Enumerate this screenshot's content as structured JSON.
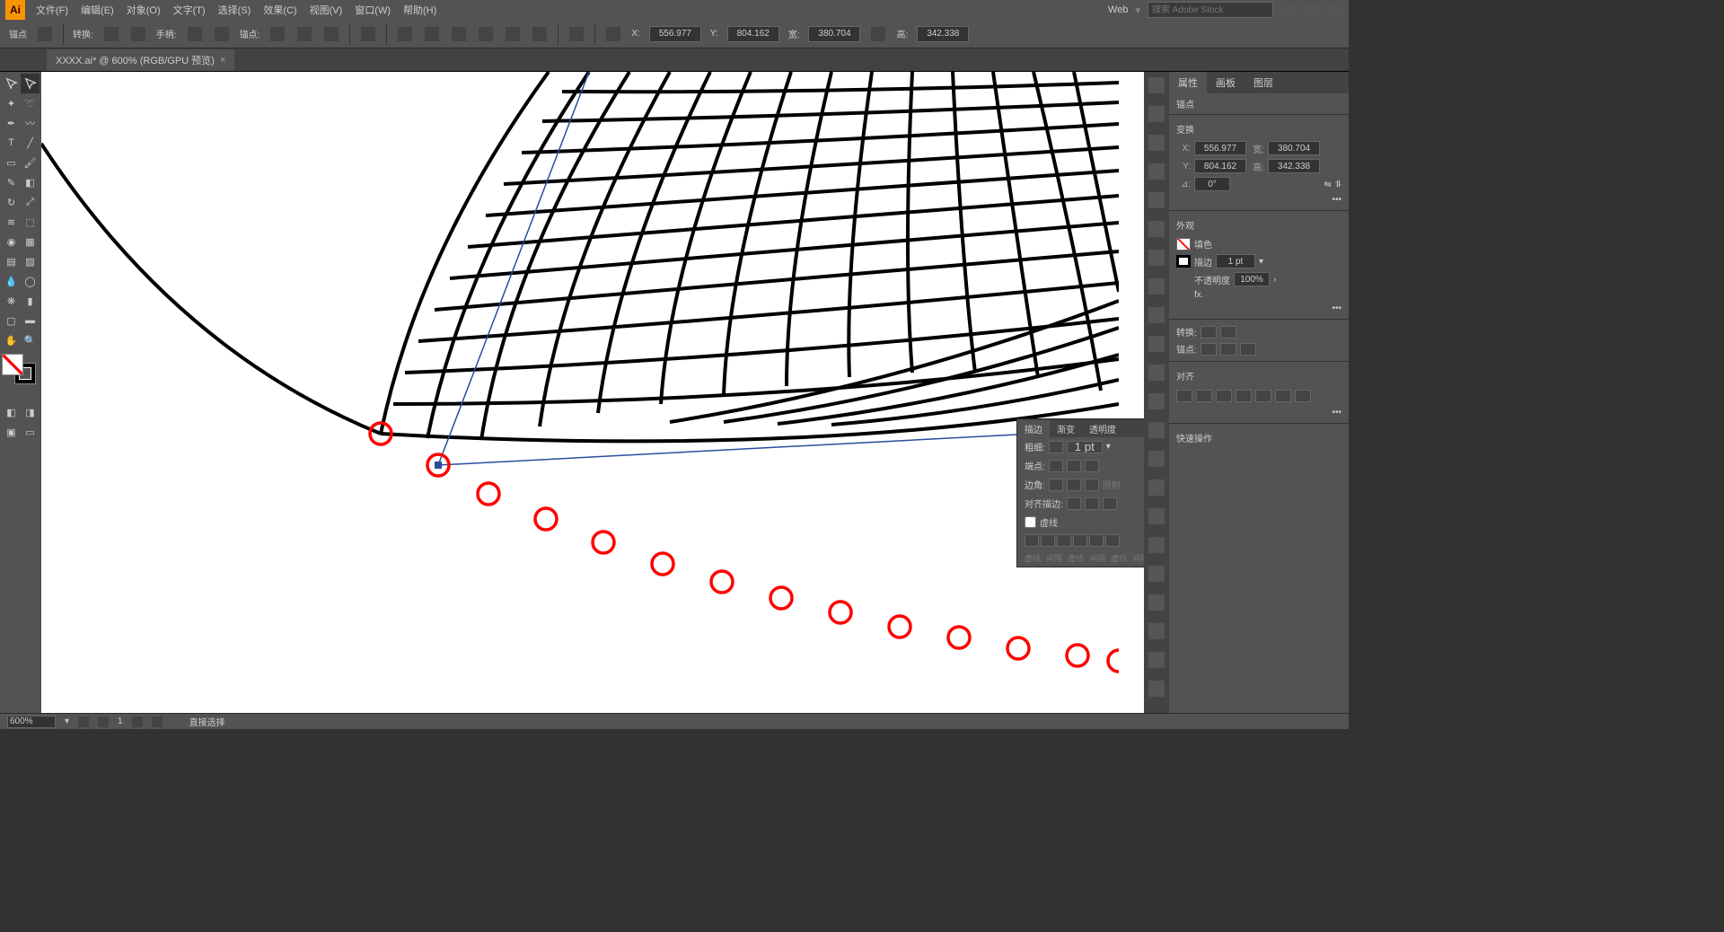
{
  "menubar": {
    "items": [
      "文件(F)",
      "编辑(E)",
      "对象(O)",
      "文字(T)",
      "选择(S)",
      "效果(C)",
      "视图(V)",
      "窗口(W)",
      "帮助(H)"
    ],
    "workspace": "Web",
    "search_placeholder": "搜索 Adobe Stock"
  },
  "controlbar": {
    "label_anchor": "锚点",
    "label_convert": "转换:",
    "label_handle": "手柄:",
    "label_anchor2": "锚点:",
    "label_x": "X:",
    "label_y": "Y:",
    "label_w": "宽:",
    "label_h": "高:",
    "x": "556.977",
    "y": "804.162",
    "w": "380.704",
    "h": "342.338"
  },
  "document": {
    "tab_label": "XXXX.ai* @ 600% (RGB/GPU 预览)"
  },
  "right_panel": {
    "tabs": [
      "属性",
      "画板",
      "图层"
    ],
    "sec_anchor": "锚点",
    "sec_transform": "变换",
    "tf": {
      "x_label": "X:",
      "y_label": "Y:",
      "w_label": "宽:",
      "h_label": "高:",
      "x": "556.977",
      "y": "804.162",
      "w": "380.704",
      "h": "342.338",
      "angle_label": "⊿:",
      "angle": "0°"
    },
    "sec_appearance": "外观",
    "fill_label": "填色",
    "stroke_label": "描边",
    "stroke_weight": "1 pt",
    "opacity_label": "不透明度",
    "opacity": "100%",
    "fx_label": "fx.",
    "sec_convert": "转换:",
    "sec_anchor3": "锚点:",
    "sec_align": "对齐",
    "sec_quick": "快速操作"
  },
  "float_stroke": {
    "tabs": [
      "描边",
      "渐变",
      "透明度"
    ],
    "weight_label": "粗细:",
    "weight": "1 pt",
    "cap_label": "端点:",
    "corner_label": "边角:",
    "limit_label": "限制:",
    "align_label": "对齐描边:",
    "dashed_label": "虚线",
    "dash_headers": [
      "虚线",
      "间隔",
      "虚线",
      "间隔",
      "虚线",
      "间隔"
    ]
  },
  "statusbar": {
    "zoom": "600%",
    "artboard_num": "1",
    "tool_label": "直接选择"
  }
}
